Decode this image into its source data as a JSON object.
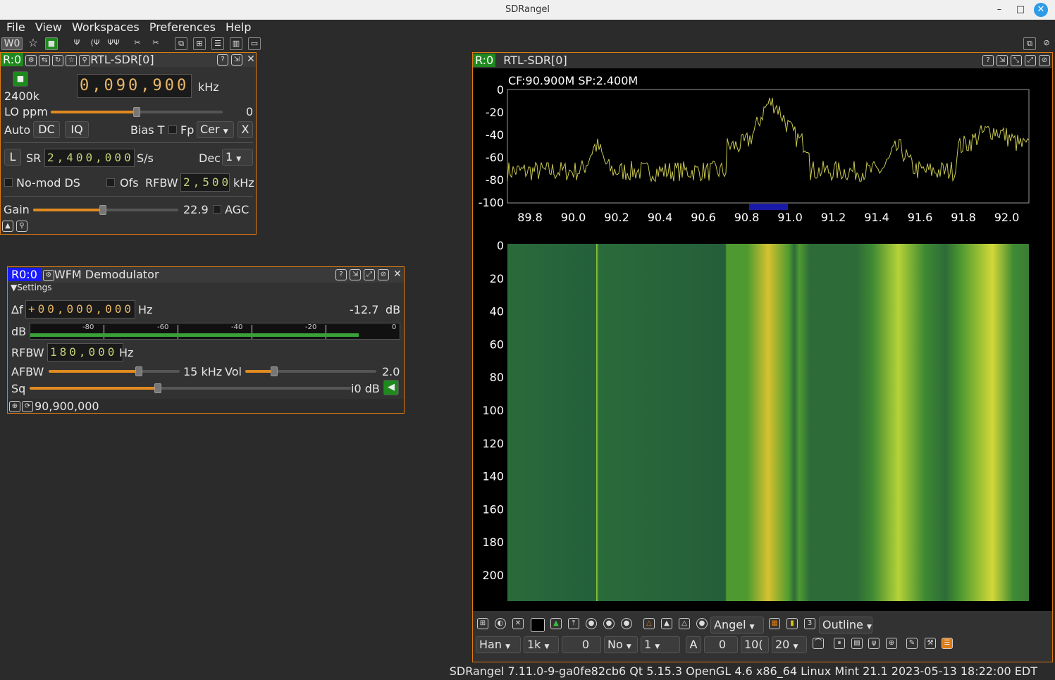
{
  "window": {
    "title": "SDRangel",
    "minimize": "–",
    "maximize": "□",
    "close": "✕"
  },
  "menu": [
    "File",
    "View",
    "Workspaces",
    "Preferences",
    "Help"
  ],
  "toolbar": {
    "workspace": "W0"
  },
  "device_panel": {
    "badge": "R:0",
    "title": "RTL-SDR[0]",
    "sample_rate_label": "2400k",
    "frequency": "0,090,900",
    "freq_unit": "kHz",
    "lo_ppm_label": "LO ppm",
    "lo_ppm_value": "0",
    "lo_ppm_level": 0.5,
    "auto_label": "Auto",
    "dc_label": "DC",
    "iq_label": "IQ",
    "bias_t_label": "Bias T",
    "fp_label": "Fp",
    "fp_value": "Cer",
    "x_label": "X",
    "l_label": "L",
    "sr_label": "SR",
    "sr_value": "2,400,000",
    "sr_unit": "S/s",
    "dec_label": "Dec",
    "dec_value": "1",
    "nomod_label": "No-mod DS",
    "ofs_label": "Ofs",
    "rfbw_label": "RFBW",
    "rfbw_value": "2,500",
    "rfbw_unit": "kHz",
    "gain_label": "Gain",
    "gain_value": "22.9",
    "gain_level": 0.48,
    "agc_label": "AGC"
  },
  "demod_panel": {
    "badge": "R0:0",
    "title": "WFM Demodulator",
    "settings_label": "▼Settings",
    "df_label": "Δf",
    "df_value": "+00,000,000",
    "df_unit": "Hz",
    "power_value": "-12.7",
    "power_unit": "dB",
    "db_label": "dB",
    "meter_ticks": [
      "-80",
      "-60",
      "-40",
      "-20",
      "0"
    ],
    "meter_level": 0.89,
    "rfbw_label": "RFBW",
    "rfbw_value": "180,000",
    "rfbw_unit": "Hz",
    "afbw_label": "AFBW",
    "afbw_value": "15 kHz",
    "afbw_level": 0.69,
    "vol_label": "Vol",
    "vol_value": "2.0",
    "vol_level": 0.22,
    "sq_label": "Sq",
    "sq_value": "50 dB",
    "sq_display": "i0 dB",
    "sq_level": 0.4,
    "footer_freq": "90,900,000"
  },
  "spectrum_panel": {
    "badge": "R:0",
    "title": "RTL-SDR[0]",
    "cf_sp": "CF:90.900M SP:2.400M",
    "y_ticks": [
      "0",
      "-20",
      "-40",
      "-60",
      "-80",
      "-100"
    ],
    "x_ticks": [
      "89.8",
      "90.0",
      "90.2",
      "90.4",
      "90.6",
      "90.8",
      "91.0",
      "91.2",
      "91.4",
      "91.6",
      "91.8",
      "92.0"
    ],
    "wf_ticks": [
      "0",
      "20",
      "40",
      "60",
      "80",
      "100",
      "120",
      "140",
      "160",
      "180",
      "200"
    ],
    "palette": "Angel",
    "outline": "Outline",
    "window_fn": "Han",
    "fft_size": "1k",
    "overlap": "0",
    "averaging_mode": "No",
    "averaging": "1",
    "a_label": "A",
    "ref_level": "0",
    "range": "100",
    "range_display": "10(",
    "fps": "20"
  },
  "colors": {
    "accent": "#e07a10",
    "trace": "#c8c850",
    "badge_green": "#1e8a1e",
    "badge_blue": "#1a1aff"
  },
  "status": "SDRangel 7.11.0-9-ga0fe82cb6 Qt 5.15.3 OpenGL 4.6 x86_64 Linux Mint 21.1 2023-05-13 18:22:00 EDT"
}
